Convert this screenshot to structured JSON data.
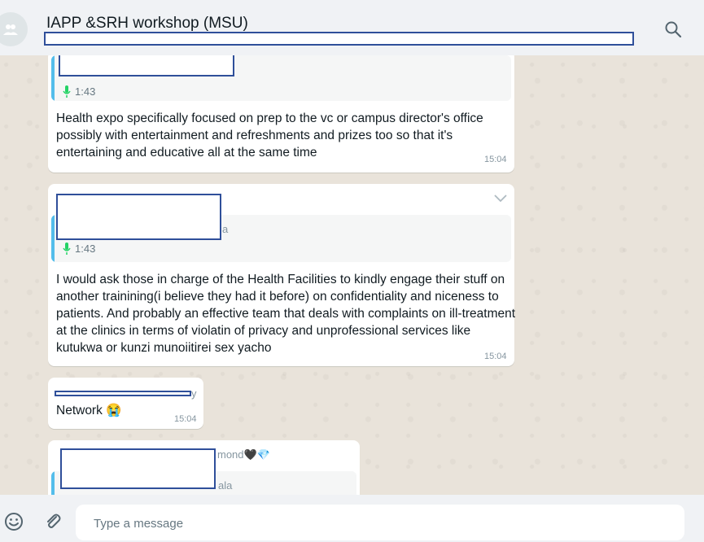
{
  "header": {
    "title": "IAPP &SRH workshop (MSU)",
    "search_icon": "search-icon",
    "avatar_icon": "group-icon"
  },
  "messages": [
    {
      "quote_duration": "1:43",
      "text": "Health expo specifically focused on prep to the vc or campus director's office possibly with entertainment and refreshments and prizes too so that it's entertaining and educative all at the same time",
      "time": "15:04"
    },
    {
      "quote_faint": "a",
      "quote_duration": "1:43",
      "text": "I would ask those in charge of the Health Facilities to kindly engage their stuff on another trainining(i believe they had it before) on confidentiality and niceness to patients. And probably an effective team that deals with complaints on ill-treatment at the clinics in terms of violatin of privacy and unprofessional services like kutukwa or kunzi munoiitirei sex yacho",
      "time": "15:04"
    },
    {
      "sender_faint": "y",
      "text": "Network 😭",
      "time": "15:04"
    },
    {
      "sender_faint": "mond🖤💎",
      "quote_faint": "ala"
    }
  ],
  "composer": {
    "placeholder": "Type a message",
    "emoji_icon": "emoji-icon",
    "attach_icon": "paperclip-icon"
  },
  "colors": {
    "header_bg": "#f0f2f5",
    "chat_bg": "#efeae2",
    "bubble_bg": "#ffffff",
    "quote_bar": "#53bdeb",
    "mic_green": "#25d366",
    "redaction_border": "#2f4f9a"
  }
}
